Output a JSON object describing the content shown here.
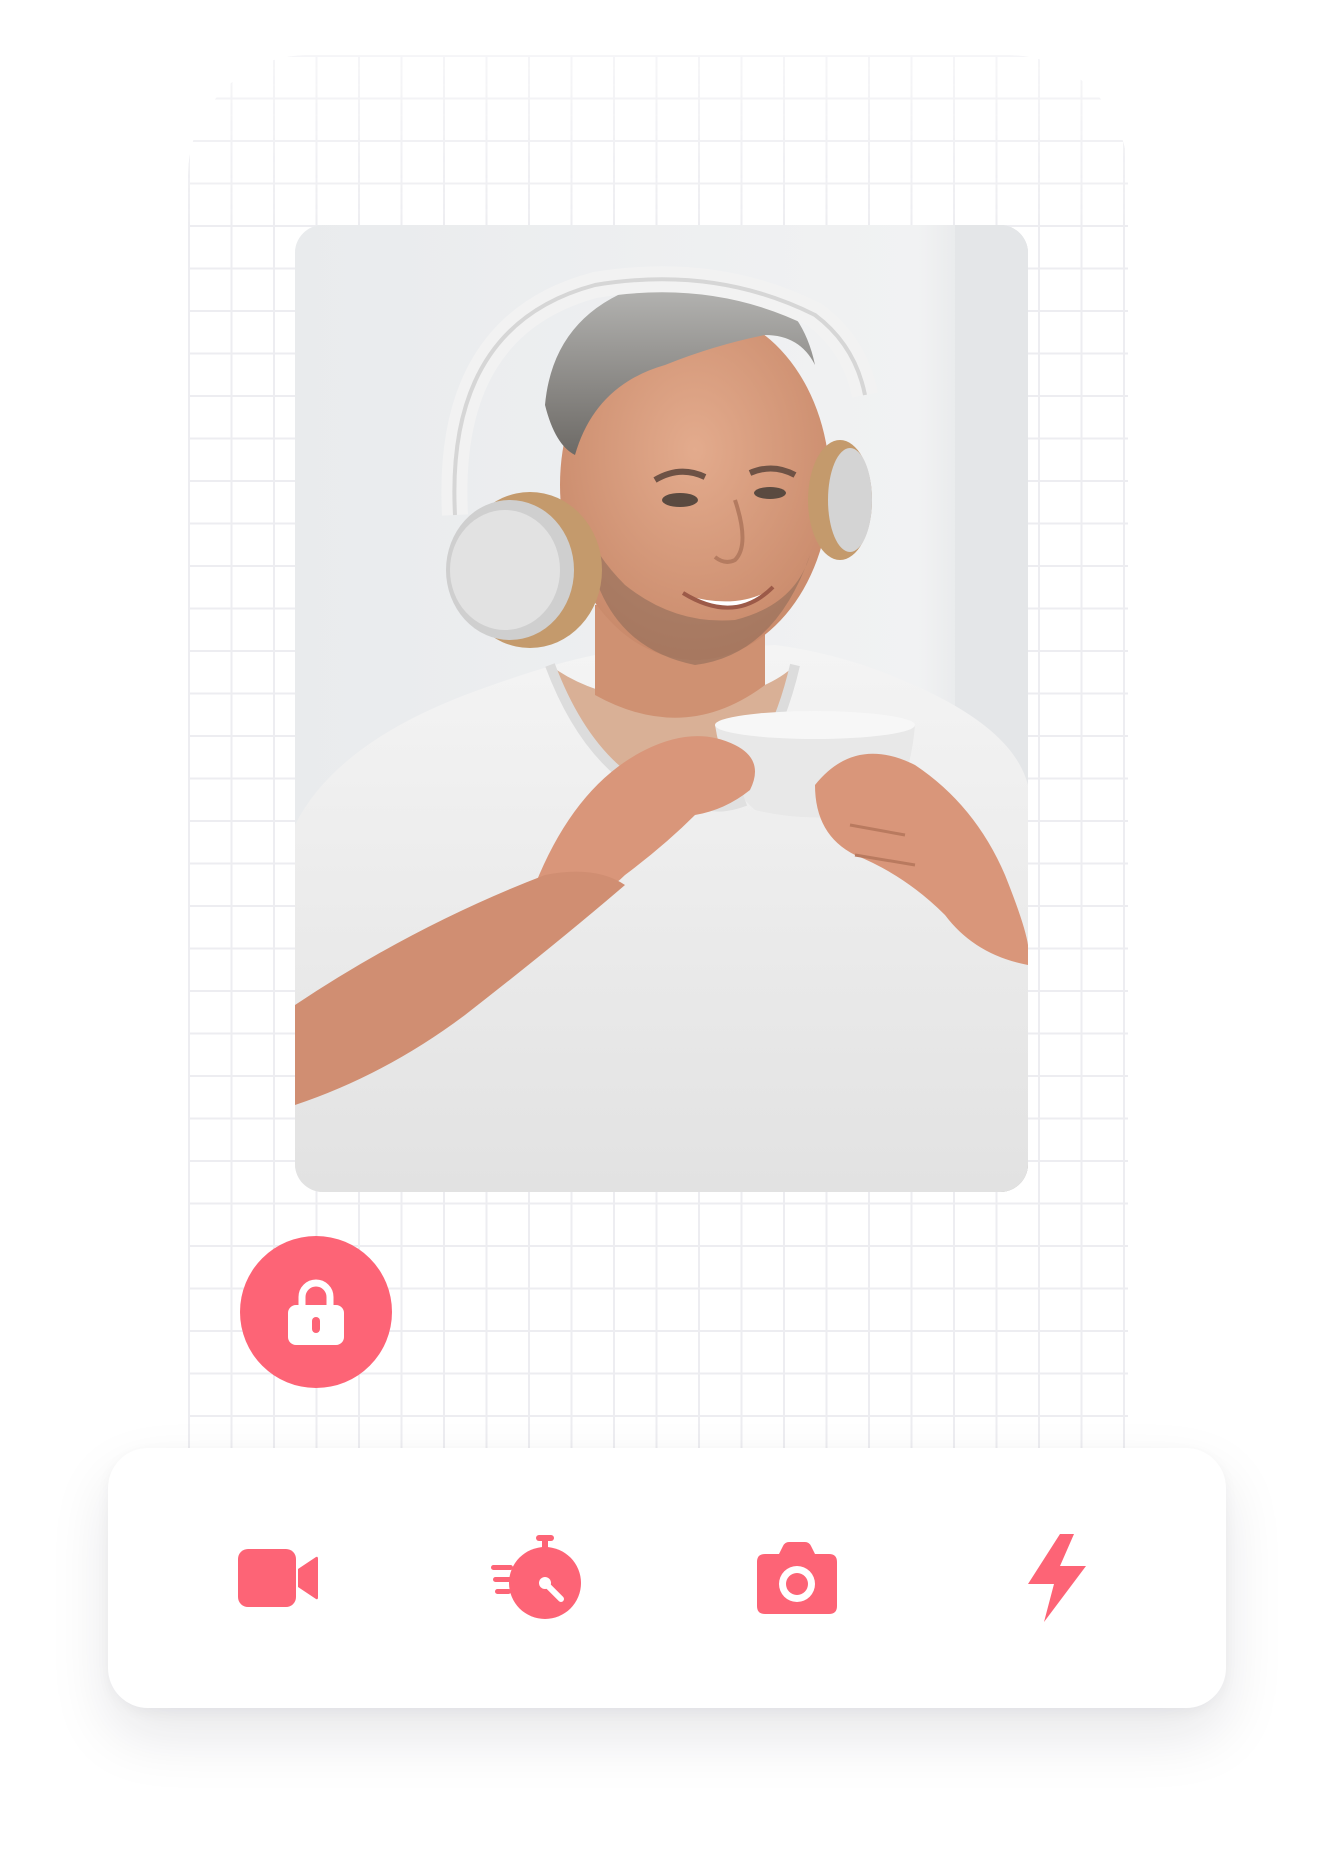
{
  "colors": {
    "accent": "#fd6476",
    "grid_line": "#ececf0",
    "card_background": "#ffffff"
  },
  "photo": {
    "subject": "man-with-headphones-holding-cup"
  },
  "lock": {
    "icon": "lock-icon"
  },
  "toolbar": {
    "items": [
      {
        "icon": "video-camera-icon"
      },
      {
        "icon": "fast-timer-icon"
      },
      {
        "icon": "camera-icon"
      },
      {
        "icon": "lightning-bolt-icon"
      }
    ]
  }
}
